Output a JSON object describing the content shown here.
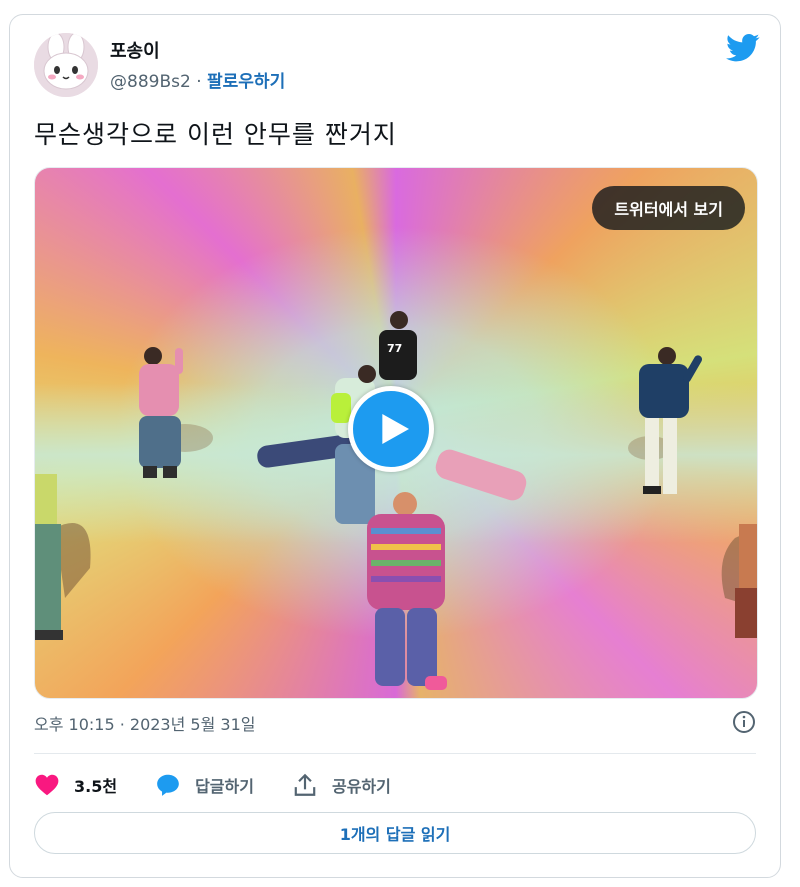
{
  "tweet": {
    "display_name": "포송이",
    "handle": "@889Bs2",
    "separator": " · ",
    "follow_label": "팔로우하기",
    "text": "무슨생각으로 이런 안무를 짠거지",
    "timestamp": "오후 10:15 · 2023년 5월 31일"
  },
  "media": {
    "watch_label": "트위터에서 보기",
    "jersey_number": "77"
  },
  "actions": {
    "likes_count": "3.5천",
    "reply_label": "답글하기",
    "share_label": "공유하기"
  },
  "footer": {
    "read_replies_label": "1개의 답글 읽기"
  },
  "colors": {
    "twitter_blue": "#1d9bf0",
    "link_blue": "#1d6fb8",
    "heart": "#f91880",
    "text_secondary": "#536471"
  },
  "icons": [
    "twitter-bird-icon",
    "play-icon",
    "info-icon",
    "heart-icon",
    "reply-bubble-icon",
    "share-icon"
  ]
}
